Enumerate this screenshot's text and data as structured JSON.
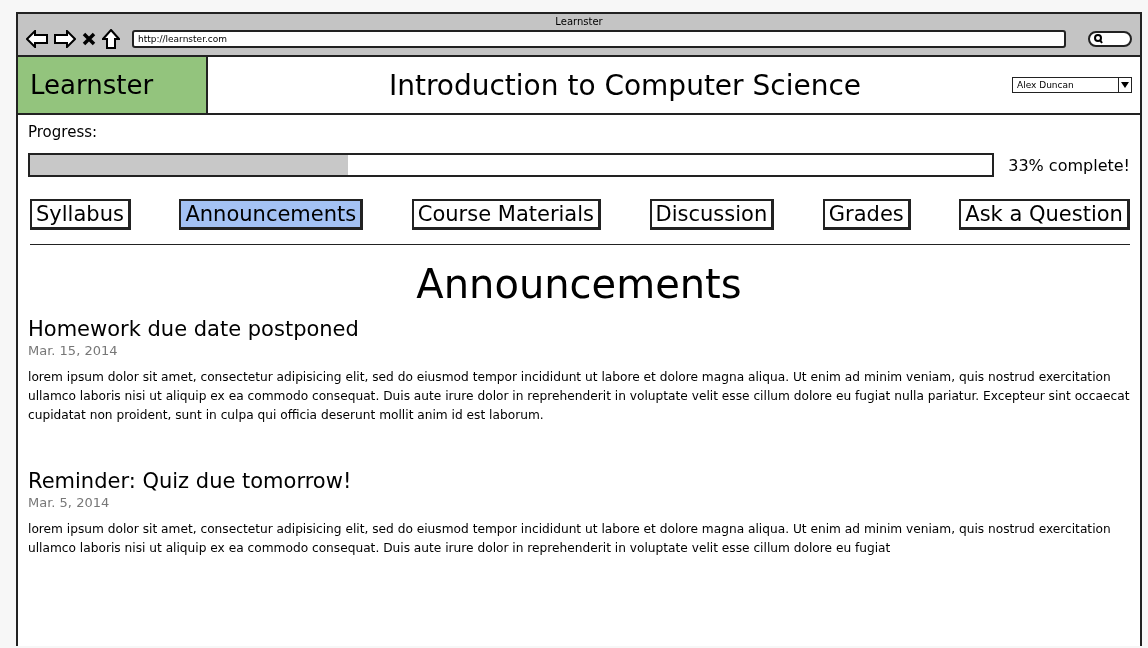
{
  "window": {
    "title": "Learnster",
    "url": "http://learnster.com"
  },
  "header": {
    "logo": "Learnster",
    "course_title": "Introduction to Computer Science",
    "user": "Alex Duncan"
  },
  "progress": {
    "label": "Progress:",
    "level": 0.33,
    "reading": "33% complete!"
  },
  "tabs": [
    {
      "label": "Syllabus",
      "selected": false
    },
    {
      "label": "Announcements",
      "selected": true
    },
    {
      "label": "Course Materials",
      "selected": false
    },
    {
      "label": "Discussion",
      "selected": false
    },
    {
      "label": "Grades",
      "selected": false
    },
    {
      "label": "Ask a Question",
      "selected": false
    }
  ],
  "page_heading": "Announcements",
  "announcements": [
    {
      "title": "Homework due date postponed",
      "date": "Mar. 15, 2014",
      "body": "lorem ipsum dolor sit amet, consectetur adipisicing elit, sed do eiusmod tempor incididunt ut labore et dolore magna aliqua. Ut enim ad minim veniam, quis nostrud exercitation ullamco laboris nisi ut aliquip ex ea commodo consequat. Duis aute irure dolor in reprehenderit in voluptate velit esse cillum dolore eu fugiat nulla pariatur. Excepteur sint occaecat cupidatat non proident, sunt in culpa qui officia deserunt mollit anim id est laborum."
    },
    {
      "title": "Reminder: Quiz due tomorrow!",
      "date": "Mar. 5, 2014",
      "body": "lorem ipsum dolor sit amet, consectetur adipisicing elit, sed do eiusmod tempor incididunt ut labore et dolore magna aliqua. Ut enim ad minim veniam, quis nostrud exercitation ullamco laboris nisi ut aliquip ex ea commodo consequat. Duis aute irure dolor in reprehenderit in voluptate velit esse cillum dolore eu fugiat"
    }
  ]
}
